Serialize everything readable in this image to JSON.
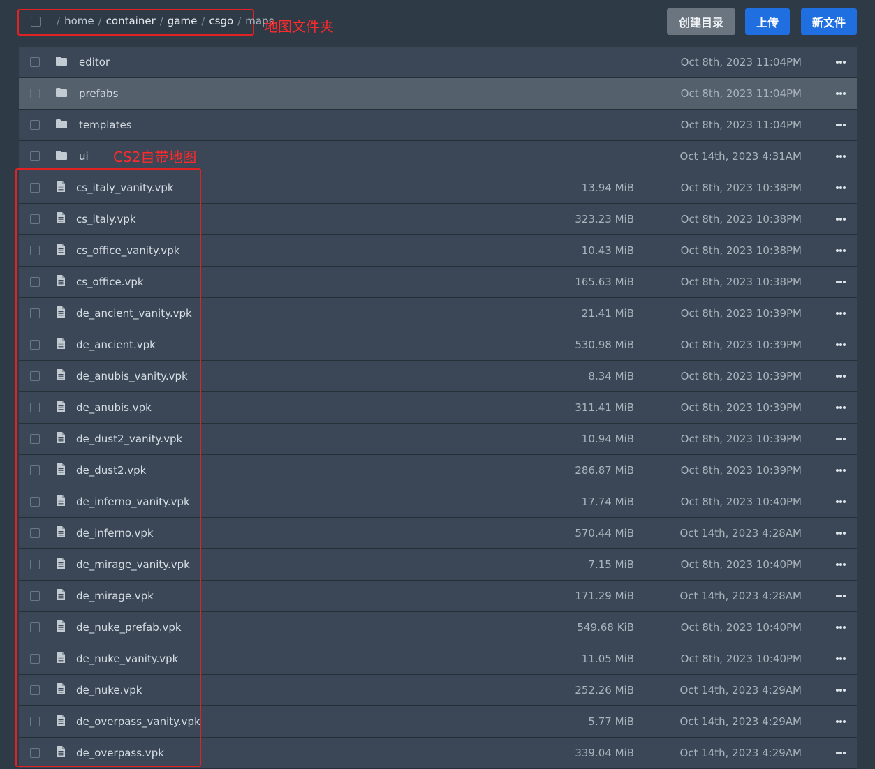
{
  "breadcrumb": {
    "segments": [
      "home",
      "container",
      "game",
      "csgo",
      "maps"
    ]
  },
  "annotations": {
    "folder_note": "地图文件夹",
    "maps_note": "CS2自带地图"
  },
  "toolbar": {
    "mkdir_label": "创建目录",
    "upload_label": "上传",
    "newfile_label": "新文件"
  },
  "colors": {
    "accent": "#1f6fe0",
    "annotation": "#e02222",
    "row_bg": "#3b4756",
    "row_highlight": "#55606d"
  },
  "files": [
    {
      "name": "editor",
      "type": "folder",
      "size": "",
      "date": "Oct 8th, 2023 11:04PM"
    },
    {
      "name": "prefabs",
      "type": "folder",
      "size": "",
      "date": "Oct 8th, 2023 11:04PM",
      "highlighted": true
    },
    {
      "name": "templates",
      "type": "folder",
      "size": "",
      "date": "Oct 8th, 2023 11:04PM"
    },
    {
      "name": "ui",
      "type": "folder",
      "size": "",
      "date": "Oct 14th, 2023 4:31AM"
    },
    {
      "name": "cs_italy_vanity.vpk",
      "type": "file",
      "size": "13.94 MiB",
      "date": "Oct 8th, 2023 10:38PM"
    },
    {
      "name": "cs_italy.vpk",
      "type": "file",
      "size": "323.23 MiB",
      "date": "Oct 8th, 2023 10:38PM"
    },
    {
      "name": "cs_office_vanity.vpk",
      "type": "file",
      "size": "10.43 MiB",
      "date": "Oct 8th, 2023 10:38PM"
    },
    {
      "name": "cs_office.vpk",
      "type": "file",
      "size": "165.63 MiB",
      "date": "Oct 8th, 2023 10:38PM"
    },
    {
      "name": "de_ancient_vanity.vpk",
      "type": "file",
      "size": "21.41 MiB",
      "date": "Oct 8th, 2023 10:39PM"
    },
    {
      "name": "de_ancient.vpk",
      "type": "file",
      "size": "530.98 MiB",
      "date": "Oct 8th, 2023 10:39PM"
    },
    {
      "name": "de_anubis_vanity.vpk",
      "type": "file",
      "size": "8.34 MiB",
      "date": "Oct 8th, 2023 10:39PM"
    },
    {
      "name": "de_anubis.vpk",
      "type": "file",
      "size": "311.41 MiB",
      "date": "Oct 8th, 2023 10:39PM"
    },
    {
      "name": "de_dust2_vanity.vpk",
      "type": "file",
      "size": "10.94 MiB",
      "date": "Oct 8th, 2023 10:39PM"
    },
    {
      "name": "de_dust2.vpk",
      "type": "file",
      "size": "286.87 MiB",
      "date": "Oct 8th, 2023 10:39PM"
    },
    {
      "name": "de_inferno_vanity.vpk",
      "type": "file",
      "size": "17.74 MiB",
      "date": "Oct 8th, 2023 10:40PM"
    },
    {
      "name": "de_inferno.vpk",
      "type": "file",
      "size": "570.44 MiB",
      "date": "Oct 14th, 2023 4:28AM"
    },
    {
      "name": "de_mirage_vanity.vpk",
      "type": "file",
      "size": "7.15 MiB",
      "date": "Oct 8th, 2023 10:40PM"
    },
    {
      "name": "de_mirage.vpk",
      "type": "file",
      "size": "171.29 MiB",
      "date": "Oct 14th, 2023 4:28AM"
    },
    {
      "name": "de_nuke_prefab.vpk",
      "type": "file",
      "size": "549.68 KiB",
      "date": "Oct 8th, 2023 10:40PM"
    },
    {
      "name": "de_nuke_vanity.vpk",
      "type": "file",
      "size": "11.05 MiB",
      "date": "Oct 8th, 2023 10:40PM"
    },
    {
      "name": "de_nuke.vpk",
      "type": "file",
      "size": "252.26 MiB",
      "date": "Oct 14th, 2023 4:29AM"
    },
    {
      "name": "de_overpass_vanity.vpk",
      "type": "file",
      "size": "5.77 MiB",
      "date": "Oct 14th, 2023 4:29AM"
    },
    {
      "name": "de_overpass.vpk",
      "type": "file",
      "size": "339.04 MiB",
      "date": "Oct 14th, 2023 4:29AM"
    }
  ]
}
